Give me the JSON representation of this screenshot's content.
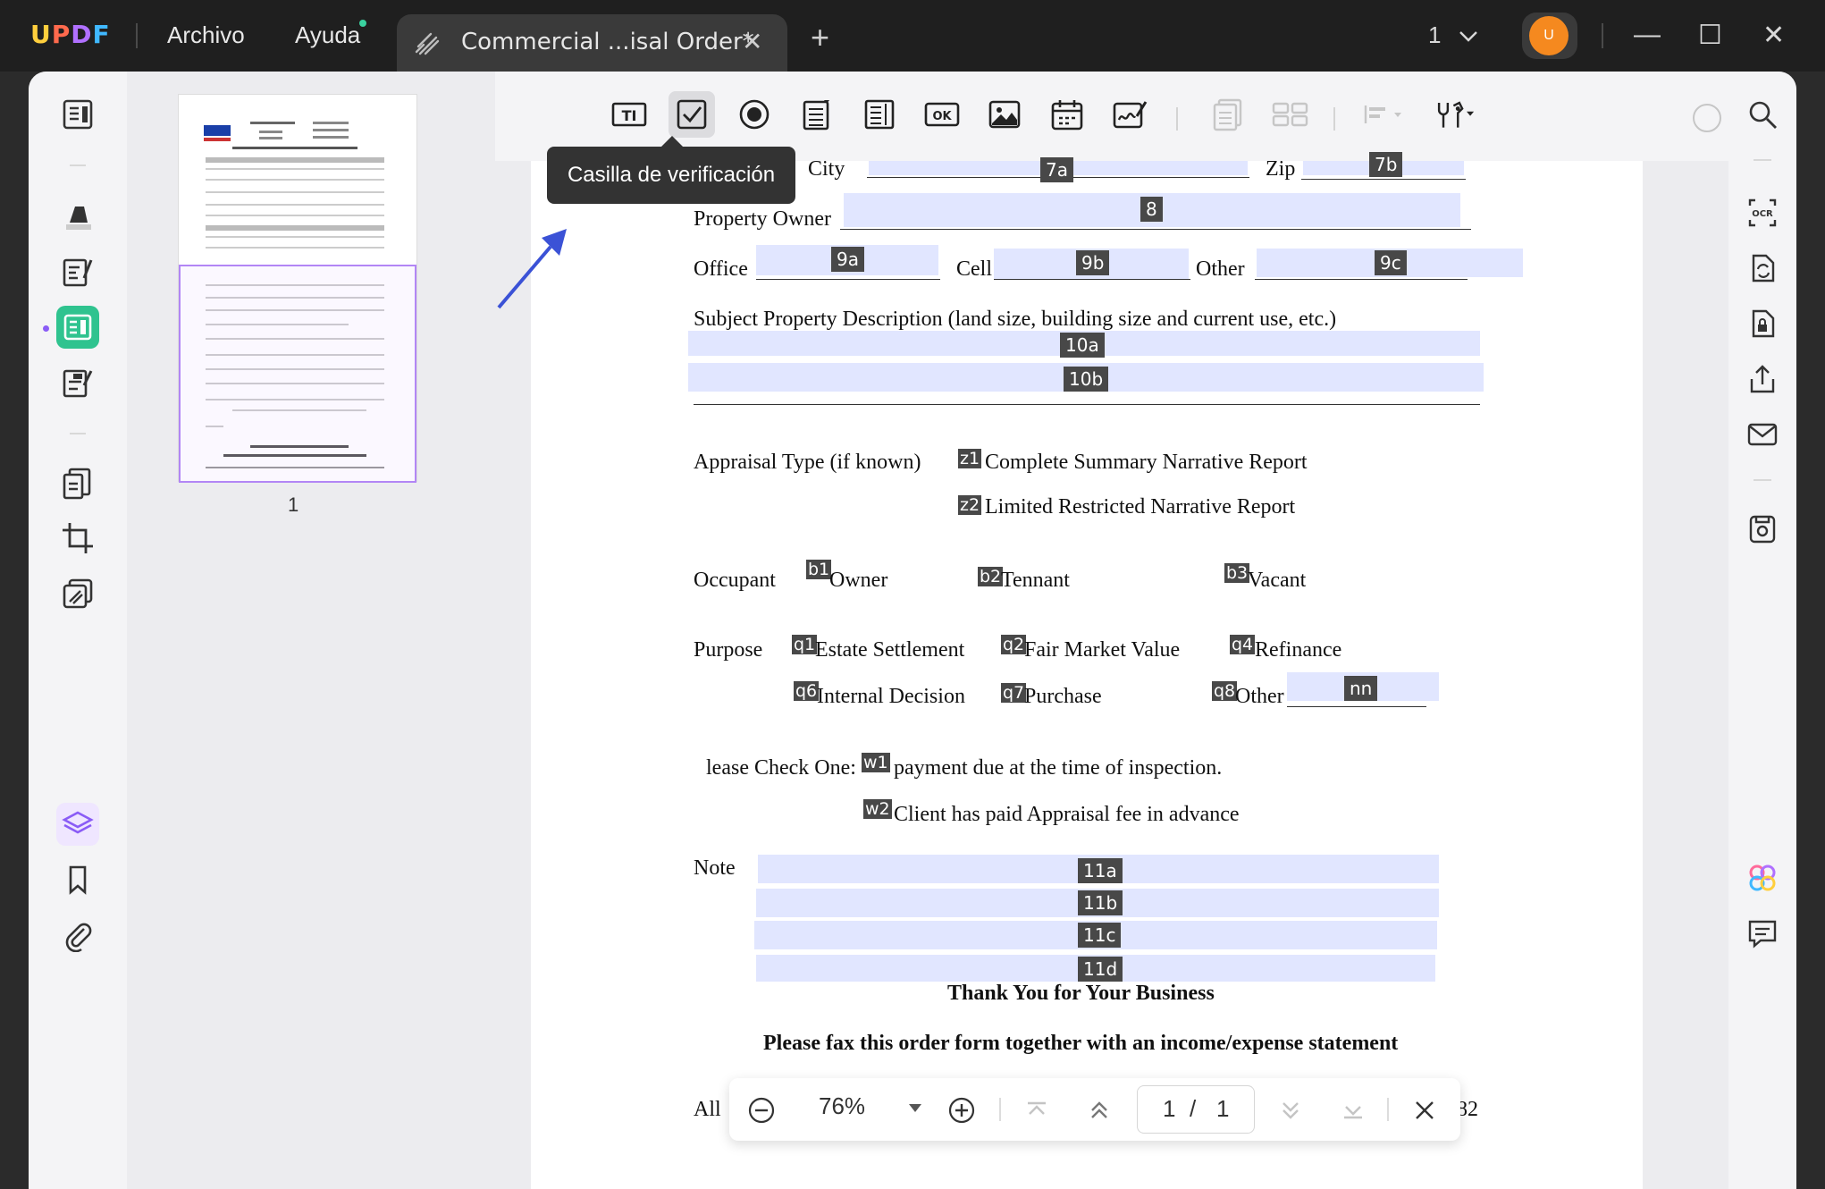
{
  "app": {
    "logo": "UPDF"
  },
  "menu": {
    "file": "Archivo",
    "help": "Ayuda"
  },
  "tab": {
    "title": "Commercial ...isal Order*",
    "close": "✕",
    "add": "+"
  },
  "window": {
    "page_selector": "1",
    "avatar_initial": "U",
    "minimize": "—",
    "maximize": "☐",
    "close": "✕"
  },
  "tooltip": {
    "text": "Casilla de verificación"
  },
  "thumbnail": {
    "page_number": "1"
  },
  "document": {
    "city": "City",
    "zip": "Zip",
    "property_owner": "Property Owner",
    "office": "Office",
    "cell": "Cell",
    "other": "Other",
    "subject_desc": "Subject Property Description (land size, building size and current use, etc.)",
    "appraisal_type": "Appraisal Type (if known)",
    "opt_complete": "Complete Summary Narrative Report",
    "opt_limited": "Limited Restricted Narrative Report",
    "occupant": "Occupant",
    "owner": "Owner",
    "tennant": "Tennant",
    "vacant": "Vacant",
    "purpose": "Purpose",
    "estate": "Estate Settlement",
    "fair_market": "Fair Market Value",
    "refinance": "Refinance",
    "internal": "Internal Decision",
    "purchase": "Purchase",
    "other2": "Other",
    "check_one": "lease Check One:",
    "payment_due": "payment due at the time of inspection.",
    "client_paid": "Client has paid Appraisal fee in advance",
    "note": "Note",
    "thanks": "Thank You for Your Business",
    "fax": "Please fax this order form together with an income/expense statement",
    "footer_left": "All",
    "footer_right": "82"
  },
  "fields": {
    "f7a": "7a",
    "f7b": "7b",
    "f8": "8",
    "f9a": "9a",
    "f9b": "9b",
    "f9c": "9c",
    "f10a": "10a",
    "f10b": "10b",
    "fnn": "nn",
    "f11a": "11a",
    "f11b": "11b",
    "f11c": "11c",
    "f11d": "11d"
  },
  "checkboxes": {
    "z1": "z1",
    "z2": "z2",
    "b1": "b1",
    "b2": "b2",
    "b3": "b3",
    "q1": "q1",
    "q2": "q2",
    "q4": "q4",
    "q6": "q6",
    "q7": "q7",
    "q8": "q8",
    "w1": "w1",
    "w2": "w2"
  },
  "zoom": {
    "level": "76%",
    "current_page": "1",
    "separator": "/",
    "total_pages": "1"
  }
}
